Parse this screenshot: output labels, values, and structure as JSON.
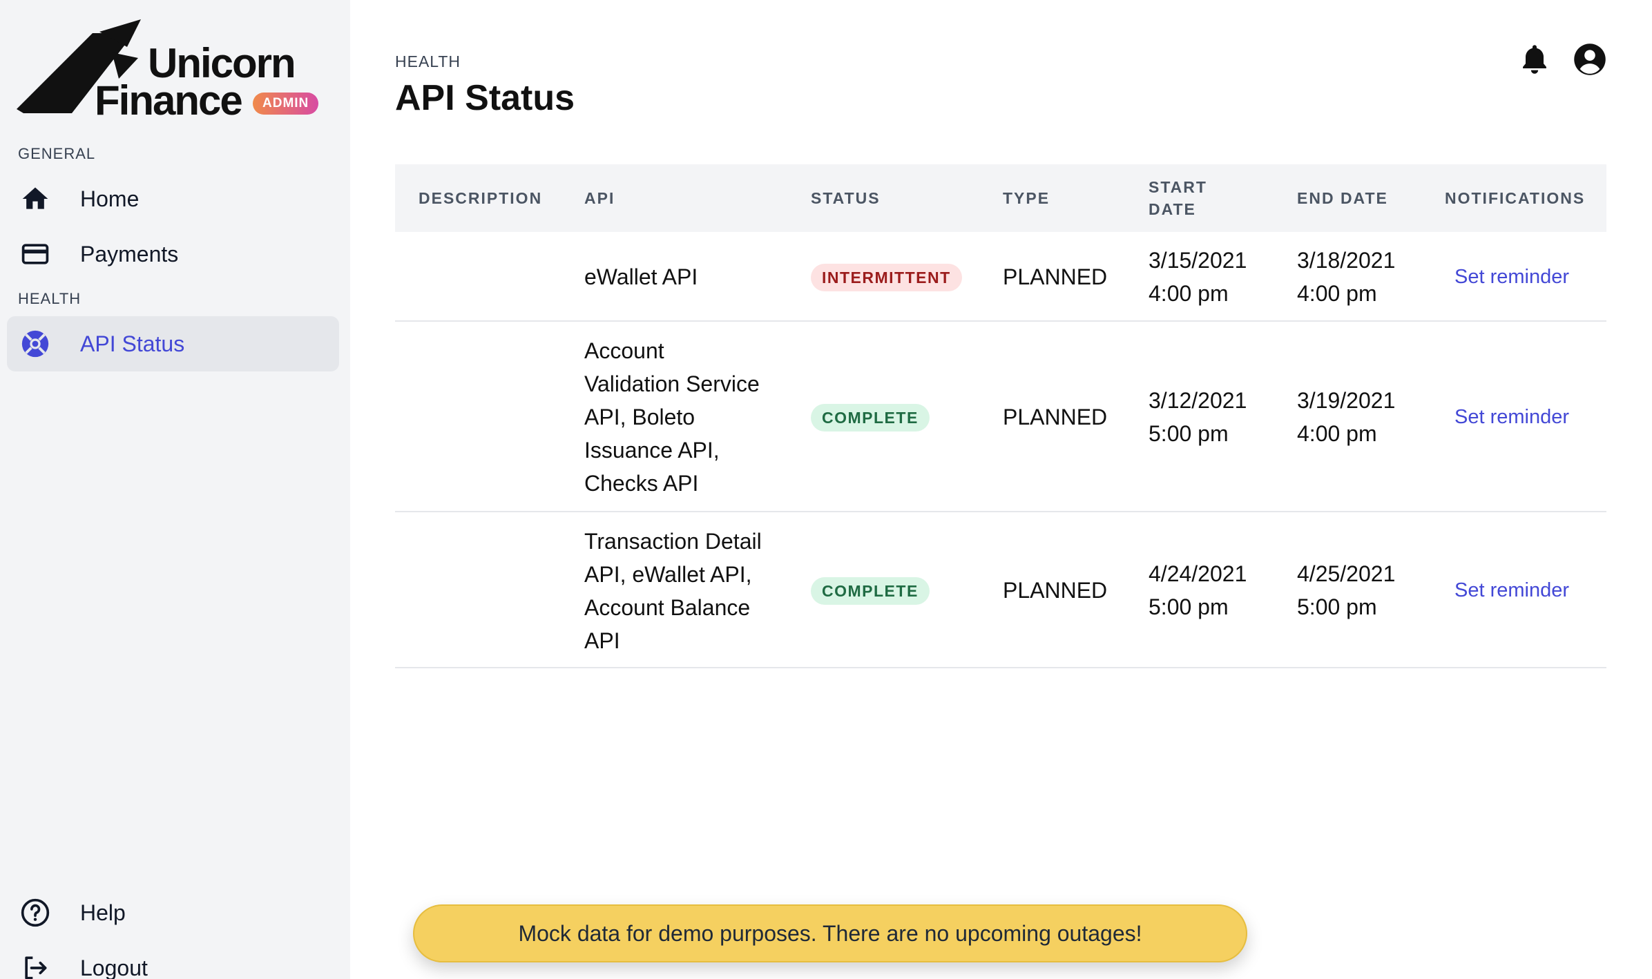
{
  "brand": {
    "line1": "Unicorn",
    "line2": "Finance",
    "badge": "ADMIN",
    "badge_gradient": [
      "#f08a4b",
      "#d74ba3"
    ]
  },
  "sidebar": {
    "sections": [
      {
        "title": "GENERAL"
      },
      {
        "title": "HEALTH"
      }
    ],
    "items": [
      {
        "label": "Home",
        "icon": "home-icon"
      },
      {
        "label": "Payments",
        "icon": "credit-card-icon"
      },
      {
        "label": "API Status",
        "icon": "lifebuoy-icon",
        "active": true
      },
      {
        "label": "Help",
        "icon": "question-circle-icon"
      },
      {
        "label": "Logout",
        "icon": "logout-icon"
      }
    ]
  },
  "header": {
    "eyebrow": "HEALTH",
    "title": "API Status",
    "icons": [
      "bell-icon",
      "user-circle-icon"
    ]
  },
  "table": {
    "columns": [
      "DESCRIPTION",
      "API",
      "STATUS",
      "TYPE",
      "START DATE",
      "END DATE",
      "NOTIFICATIONS"
    ],
    "rows": [
      {
        "description": "",
        "api": [
          "eWallet API"
        ],
        "status": "INTERMITTENT",
        "type": "PLANNED",
        "start": [
          "3/15/2021",
          "4:00 pm"
        ],
        "end": [
          "3/18/2021",
          "4:00 pm"
        ],
        "action": "Set reminder"
      },
      {
        "description": "",
        "api": [
          "Account",
          "Validation Service",
          "API, Boleto",
          "Issuance API,",
          "Checks API"
        ],
        "status": "COMPLETE",
        "type": "PLANNED",
        "start": [
          "3/12/2021",
          "5:00 pm"
        ],
        "end": [
          "3/19/2021",
          "4:00 pm"
        ],
        "action": "Set reminder"
      },
      {
        "description": "",
        "api": [
          "Transaction Detail",
          "API, eWallet API,",
          "Account Balance",
          "API"
        ],
        "status": "COMPLETE",
        "type": "PLANNED",
        "start": [
          "4/24/2021",
          "5:00 pm"
        ],
        "end": [
          "4/25/2021",
          "5:00 pm"
        ],
        "action": "Set reminder"
      }
    ]
  },
  "toast": {
    "message": "Mock data for demo purposes. There are no upcoming outages!"
  },
  "colors": {
    "accent": "#4348d6",
    "sidebar_bg": "#f3f4f6",
    "intermittent_bg": "#fde2e2",
    "intermittent_fg": "#9b1c1c",
    "complete_bg": "#d9f5e5",
    "complete_fg": "#1f6b43",
    "toast_bg": "#f5d060"
  }
}
